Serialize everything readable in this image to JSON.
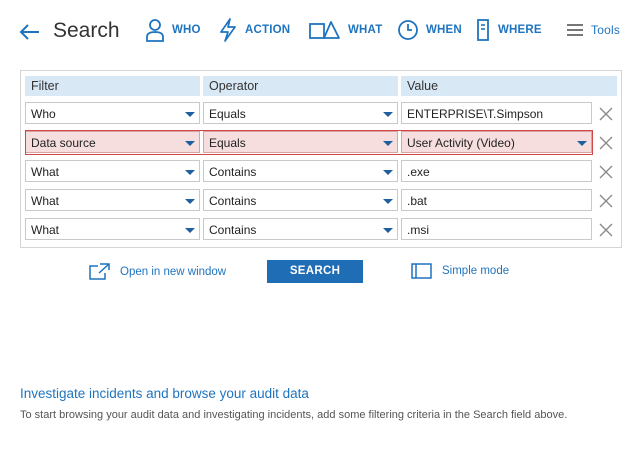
{
  "header": {
    "title": "Search",
    "nav": [
      {
        "label": "WHO",
        "icon": "person-icon"
      },
      {
        "label": "ACTION",
        "icon": "lightning-icon"
      },
      {
        "label": "WHAT",
        "icon": "shapes-icon"
      },
      {
        "label": "WHEN",
        "icon": "clock-icon"
      },
      {
        "label": "WHERE",
        "icon": "server-icon"
      }
    ],
    "tools_label": "Tools"
  },
  "filters": {
    "columns": [
      "Filter",
      "Operator",
      "Value"
    ],
    "rows": [
      {
        "filter": "Who",
        "operator": "Equals",
        "value": "ENTERPRISE\\T.Simpson",
        "highlighted": false
      },
      {
        "filter": "Data source",
        "operator": "Equals",
        "value": "User Activity (Video)",
        "highlighted": true
      },
      {
        "filter": "What",
        "operator": "Contains",
        "value": ".exe",
        "highlighted": false
      },
      {
        "filter": "What",
        "operator": "Contains",
        "value": ".bat",
        "highlighted": false
      },
      {
        "filter": "What",
        "operator": "Contains",
        "value": ".msi",
        "highlighted": false
      }
    ]
  },
  "actions": {
    "open_new_window": "Open in new window",
    "search_button": "SEARCH",
    "simple_mode": "Simple mode"
  },
  "info": {
    "title": "Investigate incidents and browse your audit data",
    "text": "To start browsing your audit data and investigating incidents, add some filtering criteria in the Search field above."
  },
  "colors": {
    "accent": "#1f74bf",
    "header_bg": "#d9e8f5",
    "highlight_bg": "#f6dede",
    "highlight_border": "#d04747",
    "button_bg": "#1f6db5"
  }
}
